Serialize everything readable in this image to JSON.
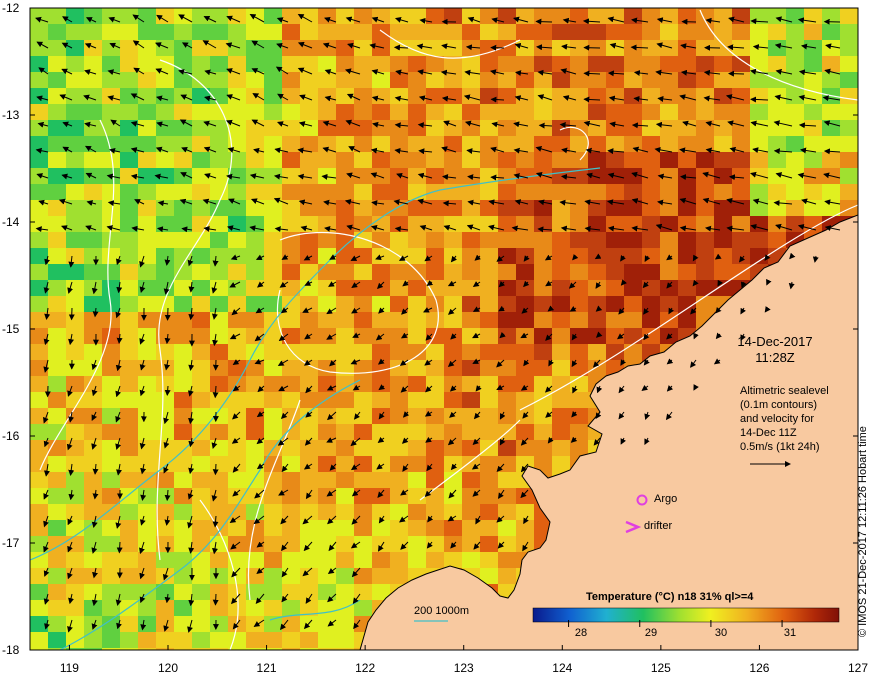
{
  "map": {
    "lat_ticks": [
      "-12",
      "-13",
      "-14",
      "-15",
      "-16",
      "-17",
      "-18"
    ],
    "lon_ticks": [
      "119",
      "120",
      "121",
      "122",
      "123",
      "124",
      "125",
      "126",
      "127"
    ],
    "lat_range": [
      -18,
      -12
    ],
    "lon_range": [
      118.6,
      127
    ],
    "colors": {
      "land": "#f8c9a0",
      "contour": "#ffffff",
      "depth_200": "#40c0c8",
      "argo": "#e040e0",
      "drifter": "#e040e0",
      "vector": "#000000"
    }
  },
  "date": {
    "line1": "14-Dec-2017",
    "line2": "11:28Z"
  },
  "altimetry": {
    "lines": [
      "Altimetric sealevel",
      "(0.1m contours)",
      "and velocity for",
      "14-Dec 11Z",
      "0.5m/s (1kt 24h)"
    ]
  },
  "legend": {
    "argo": "Argo",
    "drifter": "drifter"
  },
  "colorbar": {
    "title": "Temperature (°C) n18 31% ql>=4",
    "ticks": [
      "28",
      "29",
      "30",
      "31"
    ],
    "range": [
      27.5,
      31.8
    ]
  },
  "depth_legend": {
    "label": "200  1000m"
  },
  "credit": "© IMOS 21-Dec-2017 12:11:26 Hobart time"
}
